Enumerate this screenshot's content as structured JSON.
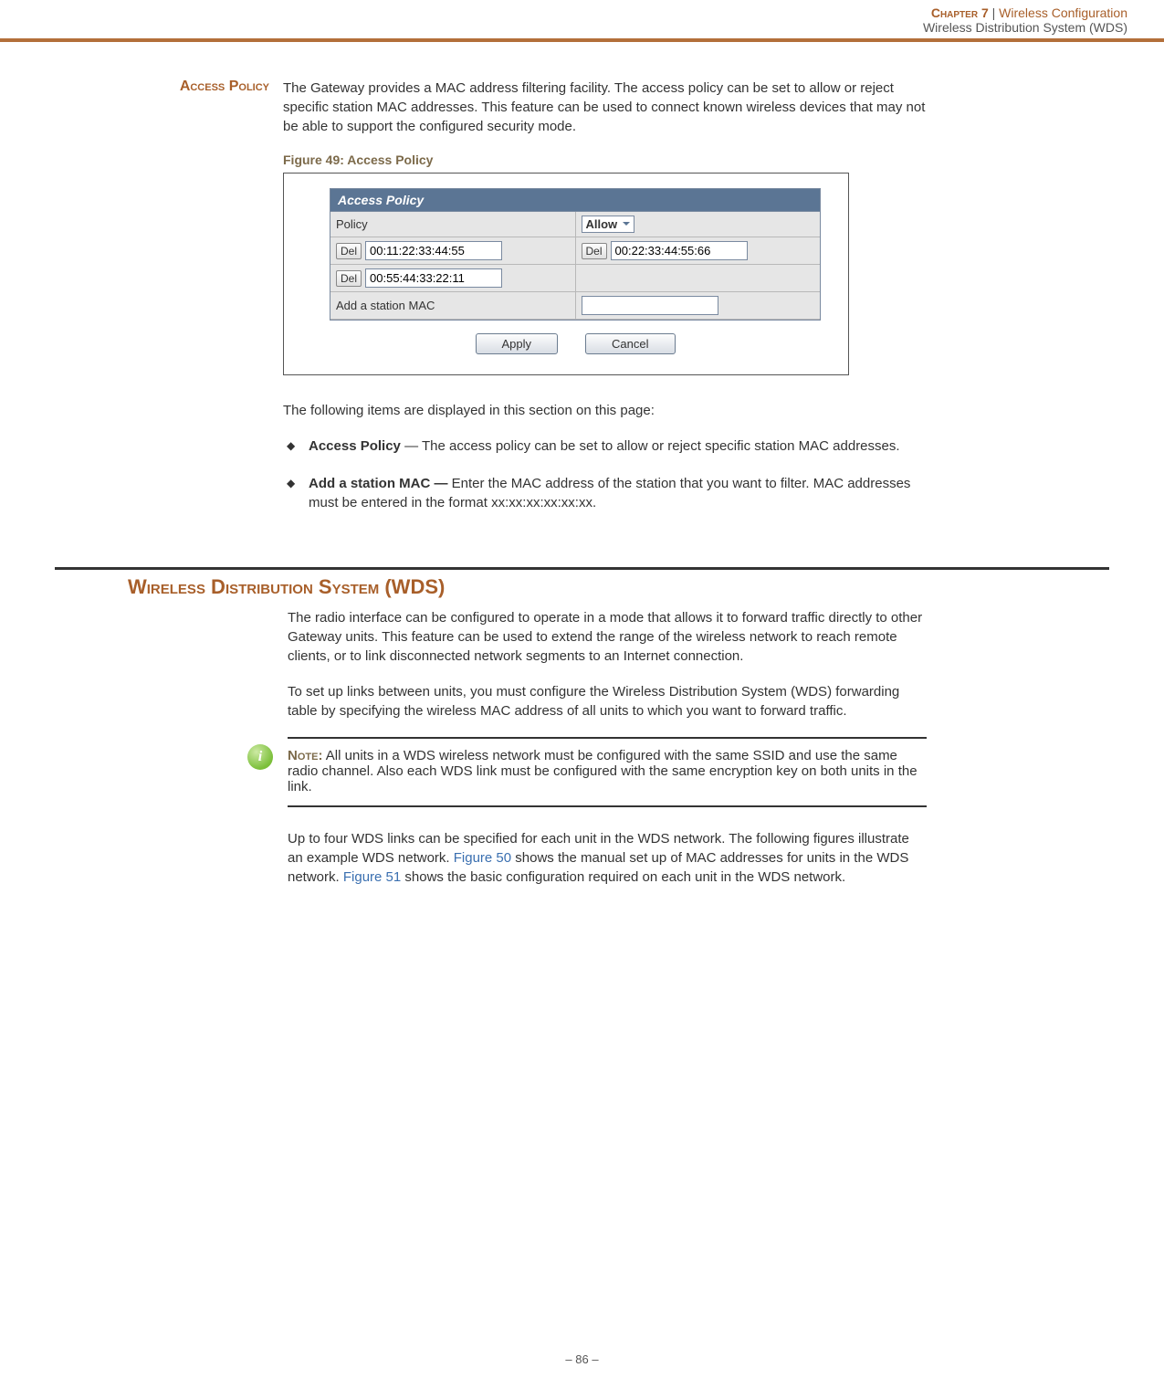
{
  "header": {
    "chapter": "Chapter 7",
    "separator": "|",
    "title": "Wireless Configuration",
    "subtitle": "Wireless Distribution System (WDS)"
  },
  "access_policy": {
    "side_heading": "Access Policy",
    "intro": "The Gateway provides a MAC address filtering facility. The access policy can be set to allow or reject specific station MAC addresses. This feature can be used to connect known wireless devices that may not be able to support the configured security mode.",
    "figure_caption": "Figure 49:  Access Policy",
    "panel": {
      "title": "Access Policy",
      "policy_label": "Policy",
      "policy_value": "Allow",
      "del_label": "Del",
      "mac1": "00:11:22:33:44:55",
      "mac2": "00:22:33:44:55:66",
      "mac3": "00:55:44:33:22:11",
      "add_label": "Add a station MAC",
      "add_value": "",
      "apply": "Apply",
      "cancel": "Cancel"
    },
    "items_lead": "The following items are displayed in this section on this page:",
    "bullets": [
      {
        "bold": "Access Policy",
        "rest": " — The access policy can be set to allow or reject specific station MAC addresses."
      },
      {
        "bold": "Add a station MAC —",
        "rest": " Enter the MAC address of the station that you want to filter. MAC addresses must be entered in the format xx:xx:xx:xx:xx:xx."
      }
    ]
  },
  "wds": {
    "title": "Wireless Distribution System (WDS)",
    "p1": "The radio interface can be configured to operate in a mode that allows it to forward traffic directly to other Gateway units. This feature can be used to extend the range of the wireless network to reach remote clients, or to link disconnected network segments to an Internet connection.",
    "p2": "To set up links between units, you must configure the Wireless Distribution System (WDS) forwarding table by specifying the wireless MAC address of all units to which you want to forward traffic.",
    "note_label": "Note:",
    "note_body": " All units in a WDS wireless network must be configured with the same SSID and use the same radio channel. Also each WDS link must be configured with the same encryption key on both units in the link.",
    "p3a": "Up to four WDS links can be specified for each unit in the WDS network. The following figures illustrate an example WDS network. ",
    "xref50": "Figure 50",
    "p3b": " shows the manual set up of MAC addresses for units in the WDS network. ",
    "xref51": "Figure 51",
    "p3c": " shows the basic configuration required on each unit in the WDS network."
  },
  "footer": "–  86  –"
}
